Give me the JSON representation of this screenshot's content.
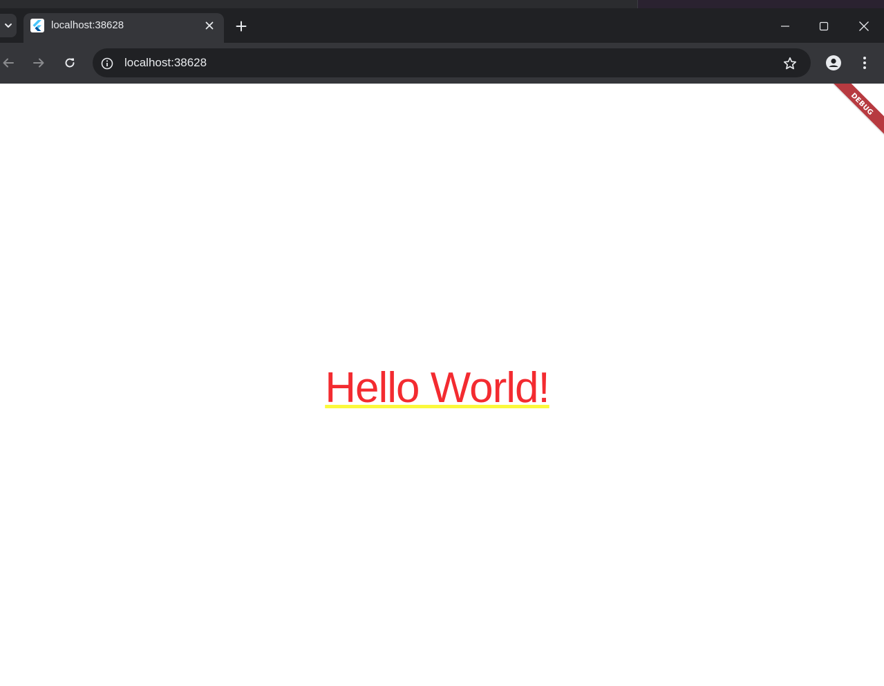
{
  "window": {
    "minimize_icon": "minimize-icon",
    "maximize_icon": "maximize-icon",
    "close_icon": "close-icon"
  },
  "tab": {
    "title": "localhost:38628",
    "favicon": "flutter-icon"
  },
  "toolbar": {
    "url": "localhost:38628"
  },
  "page": {
    "heading": "Hello World!",
    "heading_color": "#f32b30",
    "underline_color": "#fbf93c",
    "debug_banner": "DEBUG",
    "debug_banner_color": "#b73a40"
  }
}
